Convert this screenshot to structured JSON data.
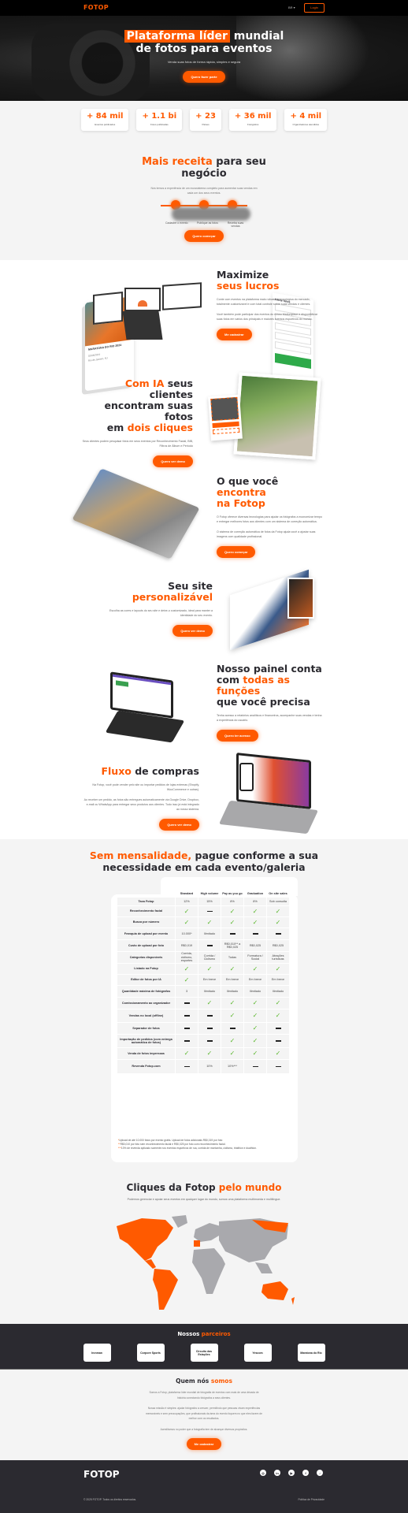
{
  "header": {
    "logo": "FOTOP",
    "language": "BR ▾",
    "login_label": "Login"
  },
  "hero": {
    "title_highlight": "Plataforma líder",
    "title_rest": " mundial",
    "title_line2": "de fotos para eventos",
    "subtitle": "Venda suas fotos de forma rápida, simples e segura",
    "cta": "Quero fazer parte"
  },
  "stats": [
    {
      "value": "+ 84 mil",
      "label": "Eventos publicados"
    },
    {
      "value": "+ 1.1 bi",
      "label": "Fotos publicadas"
    },
    {
      "value": "+ 23",
      "label": "Países"
    },
    {
      "value": "+ 36 mil",
      "label": "Fotógrafos"
    },
    {
      "value": "+ 4 mil",
      "label": "Organizadores atendidos"
    }
  ],
  "receita": {
    "title_highlight": "Mais receita",
    "title_rest": " para seu",
    "title_line2": "negócio",
    "text": "Nós temos a experiência de um ecossistema completo para aumentar suas vendas em cada um dos seus eventos.",
    "steps": [
      "Cadastre o evento",
      "Publique as fotos",
      "Receba suas vendas"
    ],
    "cta": "Quero começar",
    "card_title": "MARATONA DO RIO 2024",
    "card_date": "02/06/2024",
    "card_place": "Rio de Janeiro, RJ",
    "form_title": "Filtrar fotos"
  },
  "features": [
    {
      "title": "Maximize",
      "title_highlight": "seus lucros",
      "p1": "Conte com eventos na plataforma mais robusta e tecnológica do mercado, totalmente customizável e com total controle sobre suas vendas e clientes.",
      "p2": "Você também pode participar dos eventos do nosso Marketplace e disponibilizar suas fotos em vários dos principais e maiores eventos esportivos do mundo.",
      "cta": "Me cadastrar"
    },
    {
      "title_highlight": "Com IA",
      "title_rest": " seus clientes",
      "title_line2": "encontram suas fotos",
      "title_line3_pre": "em ",
      "title_line3_hl": "dois cliques",
      "p1": "Seus clientes podem pesquisar fotos em seus eventos por Reconhecimento Facial, BIB, Filtros de Álbum e Período",
      "cta": "Quero ver demo"
    },
    {
      "title_pre": "O que você ",
      "title_highlight": "encontra",
      "title_line2": "na Fotop",
      "p1": "O Fotop oferece diversas tecnologias para ajudar os fotógrafos a economizar tempo e entregar melhores fotos aos clientes com um sistema de correção automática.",
      "p2": "O sistema de correção automática de fotos da Fotop ajuda você a ajustar suas imagens com qualidade profissional.",
      "cta": "Quero começar"
    },
    {
      "title": "Seu site",
      "title_highlight": "personalizável",
      "p1": "Escolha as cores e layouts do seu site e deixe-o customizado, ideal para manter a identidade do seu evento.",
      "cta": "Quero ver demo"
    },
    {
      "title": "Nosso painel conta",
      "title_pre2": "com ",
      "title_highlight": "todas as funções",
      "title_line3": "que você precisa",
      "p1": "Tenha acesso a relatórios analíticos e financeiros, acompanhe suas vendas e tenha a experiência do usuário.",
      "cta": "Quero ter acesso"
    },
    {
      "title_highlight": "Fluxo",
      "title_rest": " de compras",
      "p1": "Na Fotop, você pode vender pelo site ou importar pedidos de lojas externas (Shopify, WooCommerce e outras).",
      "p2": "Ao receber um pedido, as fotos são entregues automaticamente via Google Drive, Dropbox, e-mail ou WhatsApp para entregar seus produtos aos clientes. Tudo isso já está integrado ao nosso sistema.",
      "cta": "Quero ver demo"
    }
  ],
  "pricing": {
    "title_highlight": "Sem mensalidade,",
    "title_rest": " pague conforme a sua",
    "title_line2": "necessidade em cada evento/galeria",
    "columns": [
      "Standard",
      "High volume",
      "Pay as you go",
      "Graduation",
      "On site sales"
    ],
    "rows": [
      {
        "label": "Taxa Fotop",
        "cells": [
          "12%",
          "15%",
          "8%",
          "8%",
          "Sob consulta"
        ]
      },
      {
        "label": "Reconhecimento facial",
        "cells": [
          "check",
          "dash",
          "check",
          "check",
          "check"
        ]
      },
      {
        "label": "Busca por número",
        "cells": [
          "check",
          "check",
          "check",
          "check",
          "check"
        ]
      },
      {
        "label": "Franquia de upload por evento",
        "cells": [
          "10.000*",
          "Ilimitado",
          "dash",
          "dash",
          "dash"
        ]
      },
      {
        "label": "Custo de upload por foto",
        "cells": [
          "R$0,019",
          "dash",
          "R$0,010** a R$0,025",
          "R$0,025",
          "R$0,025"
        ]
      },
      {
        "label": "Categorias disponíveis",
        "cells": [
          "Corrida, ciclismo, esportes",
          "Corrida / Ciclismo",
          "Todas",
          "Formatura / Social",
          "Atrações turísticas"
        ]
      },
      {
        "label": "Listado na Fotop",
        "cells": [
          "check",
          "check",
          "check",
          "check",
          "check"
        ]
      },
      {
        "label": "Editor de fotos por IA",
        "cells": [
          "check",
          "Em breve",
          "Em breve",
          "Em breve",
          "Em breve"
        ]
      },
      {
        "label": "Quantidade máxima de fotógrafos",
        "cells": [
          "3",
          "Ilimitado",
          "Ilimitado",
          "Ilimitado",
          "Ilimitado"
        ]
      },
      {
        "label": "Comissionamento ao organizador",
        "cells": [
          "dash",
          "check",
          "check",
          "check",
          "check"
        ]
      },
      {
        "label": "Vendas no local (offline)",
        "cells": [
          "dash",
          "dash",
          "check",
          "check",
          "check"
        ]
      },
      {
        "label": "Separador de fotos",
        "cells": [
          "dash",
          "dash",
          "dash",
          "check",
          "dash"
        ]
      },
      {
        "label": "Importação de pedidos (com entrega automática de fotos)",
        "cells": [
          "dash",
          "dash",
          "check",
          "check",
          "dash"
        ]
      },
      {
        "label": "Venda de fotos impressas",
        "cells": [
          "check",
          "check",
          "check",
          "check",
          "check"
        ]
      },
      {
        "label": "Revenda Fotop.com",
        "cells": [
          "dash",
          "10%",
          "10%***",
          "dash",
          "dash"
        ]
      }
    ],
    "notes": [
      {
        "mark": "*",
        "text": "Upload de até 10.000 fotos por evento grátis. Upload de fotos adicionais R$0,019 por foto"
      },
      {
        "mark": "**",
        "text": "R$0,010 por foto sem reconhecimento facial e R$0,025 por foto com reconhecimento facial."
      },
      {
        "mark": "***",
        "text": "10% de revenda aplicado somente nos eventos esportivos de rua, corrida de montanha, ciclismo, triathlon e duathlon."
      }
    ]
  },
  "map": {
    "title": "Cliques da Fotop ",
    "title_highlight": "pelo mundo",
    "text": "Podemos gerenciar e apoiar seus eventos em qualquer lugar do mundo, somos uma plataforma multimoeda e multilíngue.",
    "colors": {
      "active": "#ff5a00",
      "inactive": "#a9a9ad"
    }
  },
  "partners": {
    "title": "Nossos ",
    "title_highlight": "parceiros",
    "logos": [
      "Ironman",
      "Corpore Sports",
      "Circuito das Estações",
      "Yescom",
      "Maratona do Rio"
    ]
  },
  "about": {
    "title": "Quem nós ",
    "title_highlight": "somos",
    "p1": "Somos a Fotop, plataforma líder mundial de fotografia de eventos com mais de uma década de história conectando fotógrafos a seus clientes.",
    "p2": "Nossa missão é simples: ajudar fotógrafos a crescer, permitindo que pessoas vivam experiências memoráveis e sem preocupações, que profissionais da área do evento foquem no que eles fazem de melhor com os resultados.",
    "p3": "Acreditamos no poder que a fotografia tem de alcançar diversos propósitos.",
    "cta": "Me cadastrar"
  },
  "footer": {
    "logo": "FOTOP",
    "social": [
      "instagram",
      "linkedin",
      "youtube",
      "facebook",
      "tiktok"
    ],
    "copyright": "© 2025 FOTOP. Todos os direitos reservados.",
    "privacy": "Política de Privacidade"
  },
  "colors": {
    "brand": "#ff5a00",
    "dark": "#2b2a30",
    "check": "#5cb82e"
  }
}
